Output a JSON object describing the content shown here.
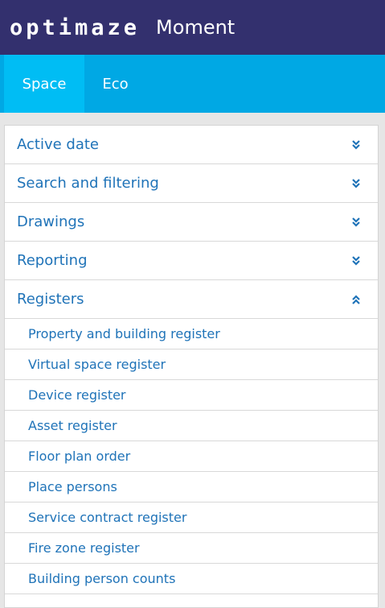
{
  "header": {
    "logo_text": "optimaze",
    "title": "Moment",
    "background_color": "#33306e"
  },
  "tabs": [
    {
      "label": "Space",
      "active": true
    },
    {
      "label": "Eco",
      "active": false
    }
  ],
  "sections": [
    {
      "label": "Active date",
      "expanded": false,
      "icon": "chevron-double-down-icon"
    },
    {
      "label": "Search and filtering",
      "expanded": false,
      "icon": "chevron-double-down-icon"
    },
    {
      "label": "Drawings",
      "expanded": false,
      "icon": "chevron-double-down-icon"
    },
    {
      "label": "Reporting",
      "expanded": false,
      "icon": "chevron-double-down-icon"
    },
    {
      "label": "Registers",
      "expanded": true,
      "icon": "chevron-double-up-icon"
    }
  ],
  "registers": [
    "Property and building register",
    "Virtual space register",
    "Device register",
    "Asset register",
    "Floor plan order",
    "Place persons",
    "Service contract register",
    "Fire zone register",
    "Building person counts"
  ],
  "colors": {
    "tabbar": "#00a8e4",
    "tab_active": "#00bdf4",
    "link": "#1f73b8"
  }
}
